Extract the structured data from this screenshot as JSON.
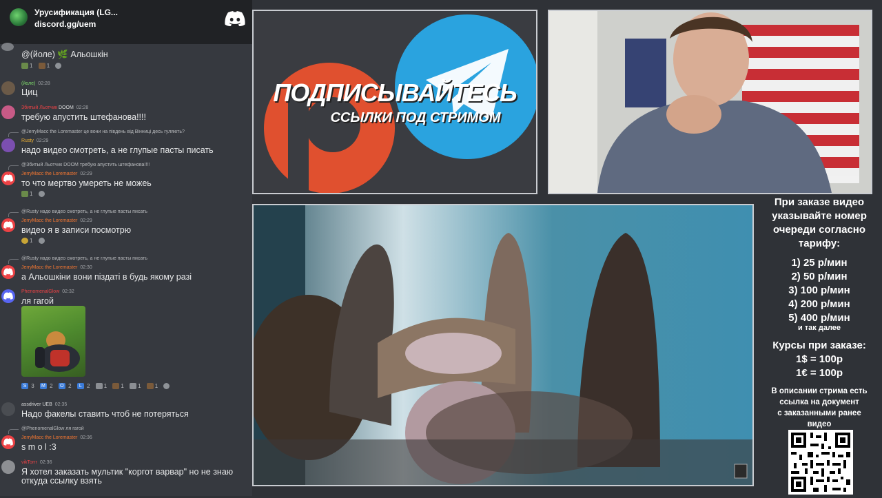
{
  "discord": {
    "server_name": "Урусификация (LG...",
    "invite": "discord.gg/uem",
    "messages": [
      {
        "body": "@(йоле) 🌿 Альошкін",
        "reactions": [
          {
            "count": "1"
          },
          {
            "count": "1"
          }
        ]
      },
      {
        "user": "(йоле)",
        "time": "02:28",
        "body": "Циц"
      },
      {
        "user": "Збитый Льотчик",
        "tag": "DOOM",
        "time": "02:28",
        "body": "требую апустить штефанова!!!!"
      },
      {
        "reply": "@JerryMacc the Loremaster це вони на південь від Вінниці десь гуляють?",
        "user": "Rusty",
        "time": "02:29",
        "body": "надо видео смотреть, а не глупые пасты писать"
      },
      {
        "reply": "@Збитый Льотчик DOOM требую апустить штефанова!!!!",
        "user": "JerryMacc the Loremaster",
        "time": "02:29",
        "body": "то что мертво умереть не можеь",
        "reactions": [
          {
            "count": "1"
          }
        ]
      },
      {
        "reply": "@Rusty надо видео смотреть, а не глупые пасты писать",
        "user": "JerryMacc the Loremaster",
        "time": "02:29",
        "body": "видео я в записи посмотрю",
        "reactions": [
          {
            "count": "1"
          }
        ]
      },
      {
        "reply": "@Rusty надо видео смотреть, а не глупые пасты писать",
        "user": "JerryMacc the Loremaster",
        "time": "02:30",
        "body": "а Альошкіни вони піздаті в будь якому разі"
      },
      {
        "user": "PhenomenalGlow",
        "time": "02:32",
        "body": "ля гагой",
        "reactions": [
          {
            "label": "S",
            "count": "3"
          },
          {
            "label": "M",
            "count": "2"
          },
          {
            "label": "O",
            "count": "2"
          },
          {
            "label": "L",
            "count": "2"
          },
          {
            "count": "1"
          },
          {
            "count": "1"
          },
          {
            "count": "1"
          },
          {
            "count": "1"
          }
        ]
      },
      {
        "user": "assdriver",
        "tag": "UEB",
        "time": "02:35",
        "body": "Надо факелы ставить чтоб не потеряться"
      },
      {
        "reply": "@PhenomenalGlow ля гагой",
        "user": "JerryMacc the Loremaster",
        "time": "02:36",
        "body": "s m o l :3"
      },
      {
        "user": "vikTorrr",
        "time": "02:36",
        "body": "Я хотел заказать мультик \"коргот варвар\" но не знаю",
        "body2": "откуда ссылку взять"
      }
    ]
  },
  "promo": {
    "title": "ПОДПИСЫВАЙТЕСЬ",
    "subtitle": "ССЫЛКИ ПОД СТРИМОМ"
  },
  "info": {
    "intro": [
      "При заказе видео",
      "указывайте номер",
      "очереди согласно",
      "тарифу:"
    ],
    "tariffs": [
      "1) 25 р/мин",
      "2) 50 р/мин",
      "3) 100 р/мин",
      "4) 200 р/мин",
      "5) 400 р/мин"
    ],
    "etc": "и так далее",
    "courses": [
      "Курсы при заказе:",
      "1$ = 100р",
      "1€ = 100р"
    ],
    "note": [
      "В описании стрима есть",
      "ссылка на документ",
      "с заказанными ранее",
      "видео"
    ]
  },
  "colors": {
    "discord_bg": "#36393f",
    "header_bg": "#202225",
    "page_bg": "#2f3237",
    "patreon": "#e0502f",
    "telegram": "#2aa3df"
  }
}
